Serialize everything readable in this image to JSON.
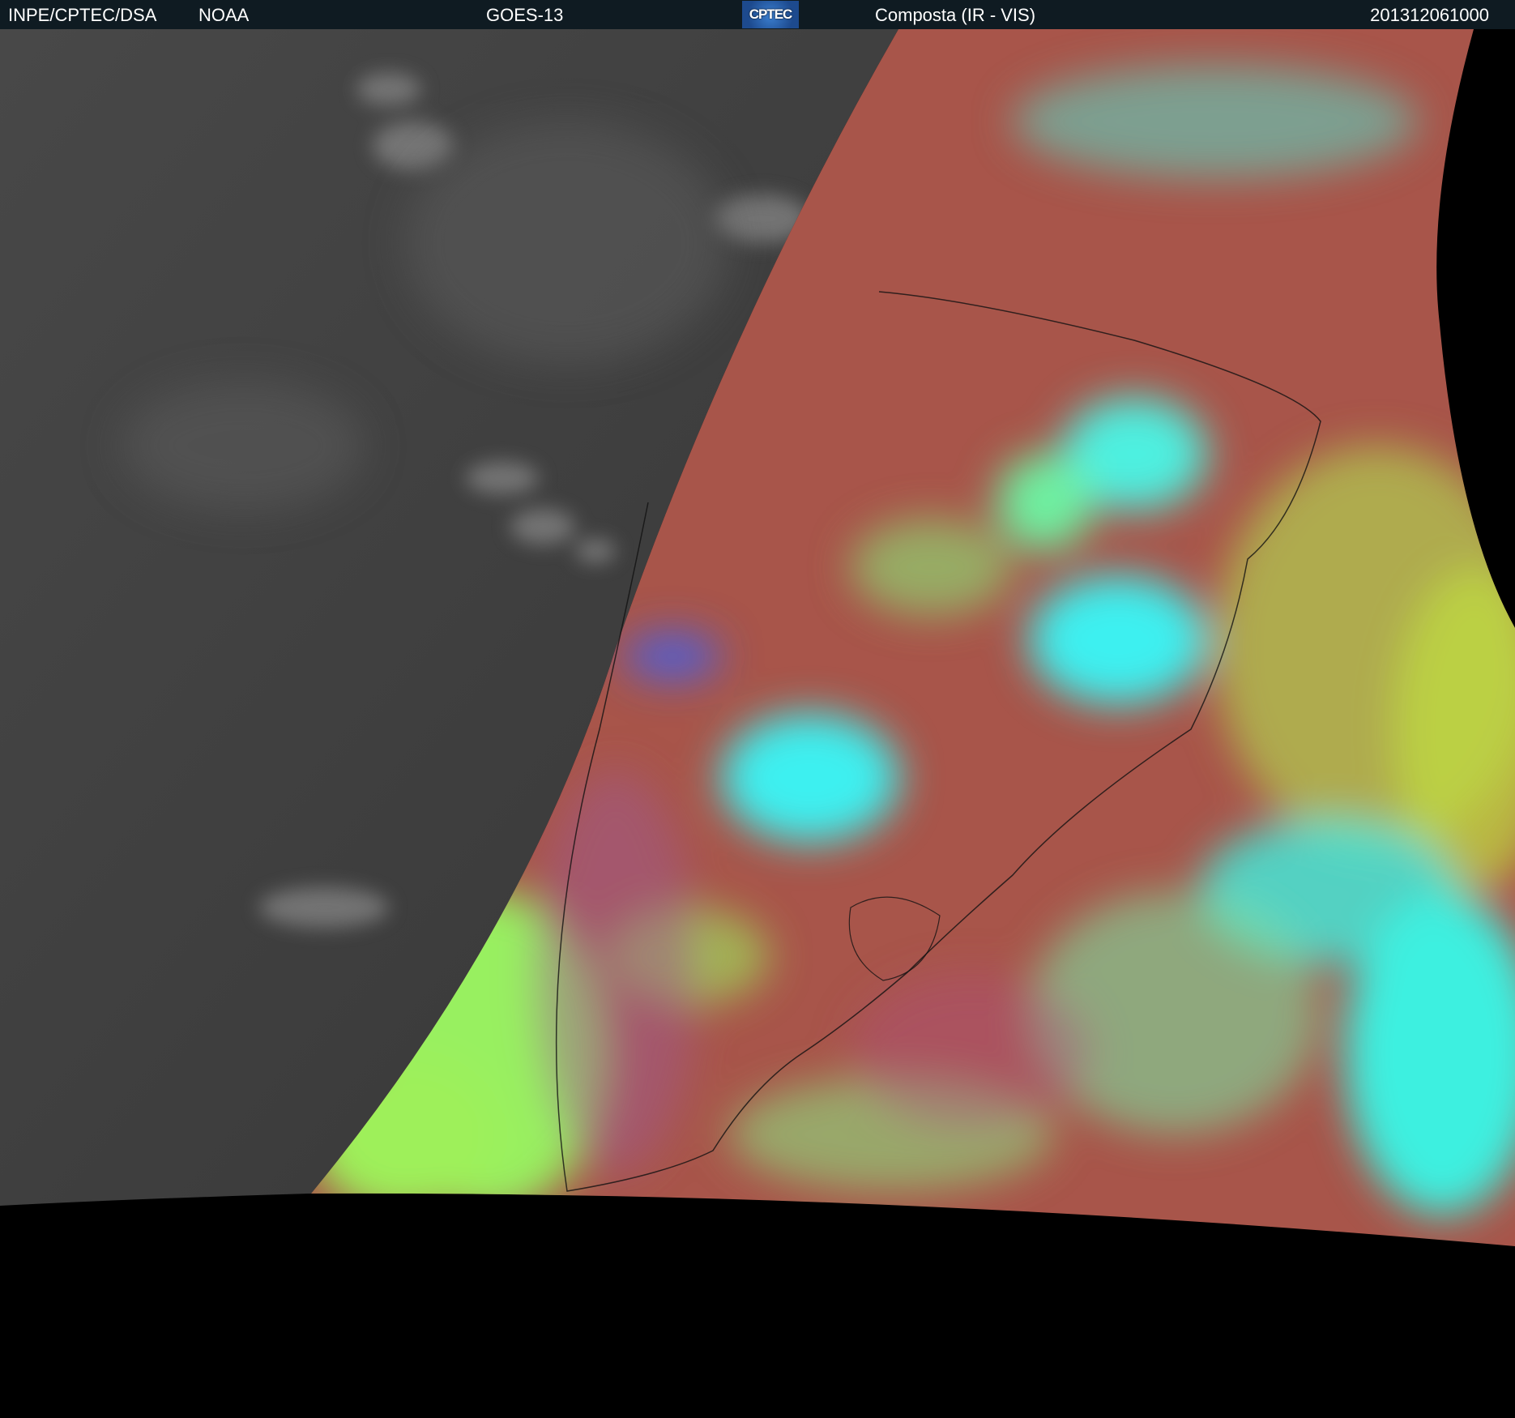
{
  "header": {
    "agency": "INPE/CPTEC/DSA",
    "partner": "NOAA",
    "satellite": "GOES-13",
    "logo_text": "CPTEC",
    "product": "Composta (IR - VIS)",
    "timestamp": "201312061000"
  },
  "colors": {
    "header_bg": "#0f1b22",
    "night_gray": "#3a3a3a",
    "land_red": "#a8554a",
    "cloud_cyan": "#3ef0f0",
    "cloud_green": "#9ef05a"
  }
}
